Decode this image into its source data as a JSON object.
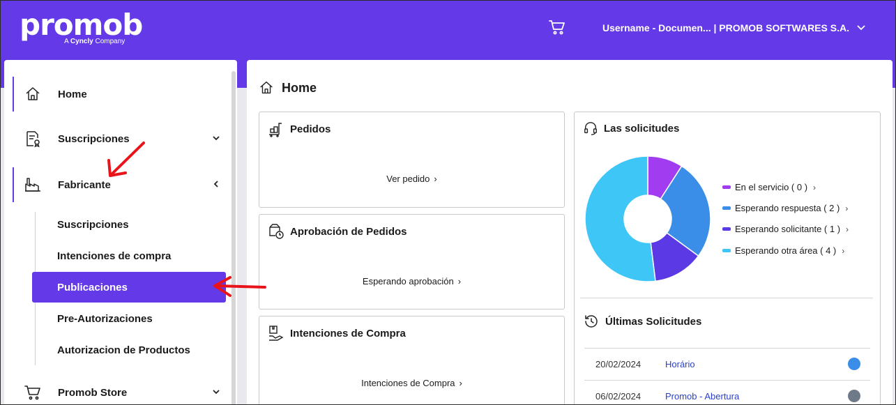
{
  "header": {
    "logo_word": "promob",
    "logo_sub_prefix": "A ",
    "logo_sub_brand": "Cyncly",
    "logo_sub_suffix": " Company",
    "user_label": "Username - Documen... | PROMOB SOFTWARES S.A."
  },
  "sidebar": {
    "items": [
      {
        "label": "Home",
        "icon": "home-icon"
      },
      {
        "label": "Suscripciones",
        "icon": "document-badge-icon"
      },
      {
        "label": "Fabricante",
        "icon": "factory-icon"
      },
      {
        "label": "Promob Store",
        "icon": "cart-icon"
      }
    ],
    "sub_items": [
      {
        "label": "Suscripciones"
      },
      {
        "label": "Intenciones de compra"
      },
      {
        "label": "Publicaciones"
      },
      {
        "label": "Pre-Autorizaciones"
      },
      {
        "label": "Autorizacion de Productos"
      }
    ]
  },
  "main": {
    "title": "Home",
    "cards": {
      "pedidos": {
        "title": "Pedidos",
        "link": "Ver pedido"
      },
      "aprobacion": {
        "title": "Aprobación de Pedidos",
        "link": "Esperando aprobación"
      },
      "intenciones": {
        "title": "Intenciones de Compra",
        "link": "Intenciones de Compra"
      }
    },
    "solicitudes": {
      "title": "Las solicitudes",
      "legend": [
        {
          "label": "En el servicio ( 0 )",
          "color": "#a23cf0"
        },
        {
          "label": "Esperando respuesta ( 2 )",
          "color": "#3b8ee8"
        },
        {
          "label": "Esperando solicitante ( 1 )",
          "color": "#5b3ae6"
        },
        {
          "label": "Esperando otra área ( 4 )",
          "color": "#3ec6f6"
        }
      ]
    },
    "chart_data": {
      "type": "pie",
      "categories": [
        "En el servicio",
        "Esperando respuesta",
        "Esperando solicitante",
        "Esperando otra área"
      ],
      "values": [
        0,
        2,
        1,
        4
      ],
      "colors": [
        "#a23cf0",
        "#3b8ee8",
        "#5b3ae6",
        "#3ec6f6"
      ]
    },
    "ultimas": {
      "title": "Últimas Solicitudes",
      "rows": [
        {
          "date": "20/02/2024",
          "name": "Horário",
          "status_color": "#3b8ee8"
        },
        {
          "date": "06/02/2024",
          "name": "Promob - Abertura",
          "status_color": "#6e7a87"
        }
      ]
    }
  },
  "colors": {
    "brand": "#6339e8"
  }
}
